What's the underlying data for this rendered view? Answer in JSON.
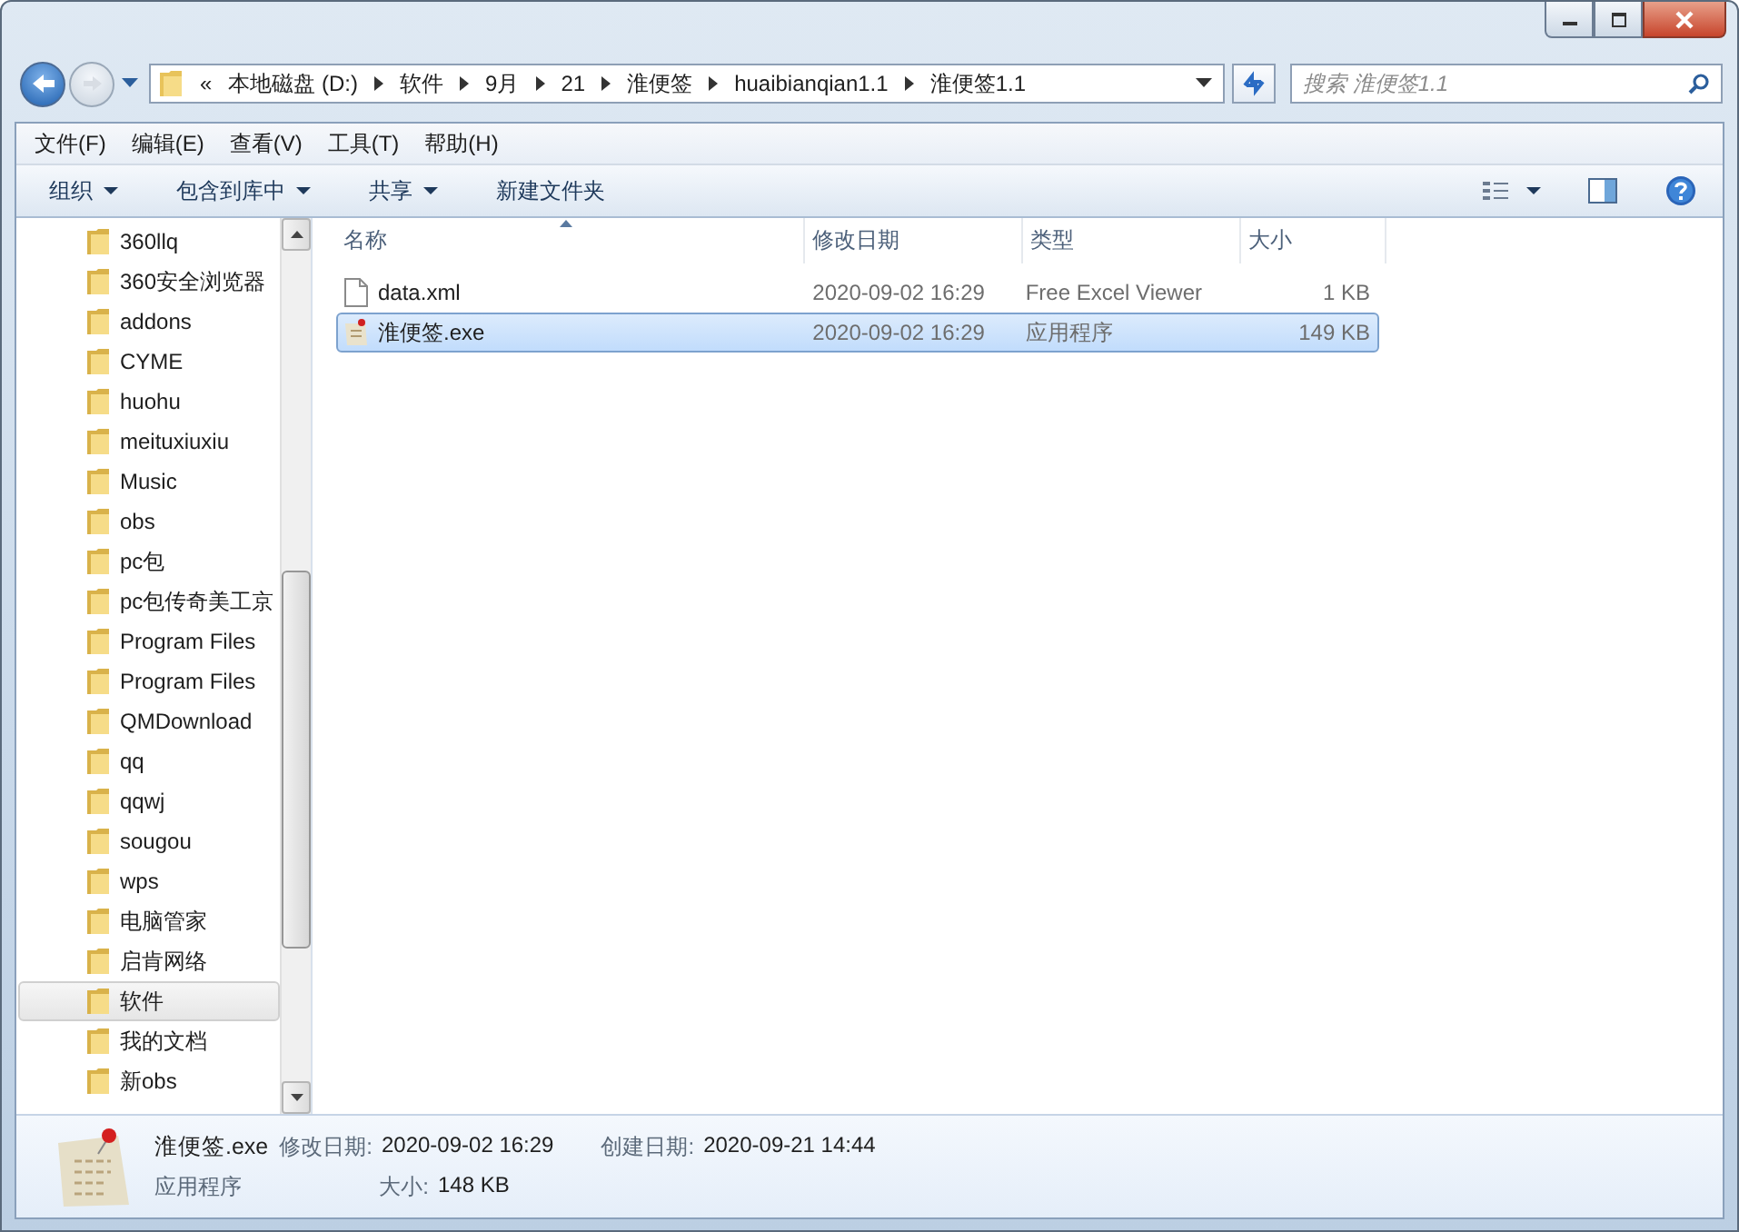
{
  "address": {
    "overflow": "«",
    "segments": [
      "本地磁盘 (D:)",
      "软件",
      "9月",
      "21",
      "淮便签",
      "huaibianqian1.1",
      "淮便签1.1"
    ]
  },
  "search": {
    "placeholder": "搜索 淮便签1.1"
  },
  "menu": [
    "文件(F)",
    "编辑(E)",
    "查看(V)",
    "工具(T)",
    "帮助(H)"
  ],
  "toolbar": [
    {
      "label": "组织",
      "dropdown": true
    },
    {
      "label": "包含到库中",
      "dropdown": true
    },
    {
      "label": "共享",
      "dropdown": true
    },
    {
      "label": "新建文件夹",
      "dropdown": false
    }
  ],
  "sidebar": {
    "items": [
      {
        "label": "360llq",
        "selected": false
      },
      {
        "label": "360安全浏览器",
        "selected": false
      },
      {
        "label": "addons",
        "selected": false
      },
      {
        "label": "CYME",
        "selected": false
      },
      {
        "label": "huohu",
        "selected": false
      },
      {
        "label": "meituxiuxiu",
        "selected": false
      },
      {
        "label": "Music",
        "selected": false
      },
      {
        "label": "obs",
        "selected": false
      },
      {
        "label": "pc包",
        "selected": false
      },
      {
        "label": "pc包传奇美工京",
        "selected": false
      },
      {
        "label": "Program Files",
        "selected": false
      },
      {
        "label": "Program Files",
        "selected": false
      },
      {
        "label": "QMDownload",
        "selected": false
      },
      {
        "label": "qq",
        "selected": false
      },
      {
        "label": "qqwj",
        "selected": false
      },
      {
        "label": "sougou",
        "selected": false
      },
      {
        "label": "wps",
        "selected": false
      },
      {
        "label": "电脑管家",
        "selected": false
      },
      {
        "label": "启肯网络",
        "selected": false
      },
      {
        "label": "软件",
        "selected": true
      },
      {
        "label": "我的文档",
        "selected": false
      },
      {
        "label": "新obs",
        "selected": false
      }
    ]
  },
  "table": {
    "columns": [
      {
        "label": "名称",
        "sorted": true
      },
      {
        "label": "修改日期",
        "sorted": false
      },
      {
        "label": "类型",
        "sorted": false
      },
      {
        "label": "大小",
        "sorted": false
      }
    ],
    "rows": [
      {
        "kind": "document",
        "name": "data.xml",
        "date": "2020-09-02 16:29",
        "type": "Free Excel Viewer",
        "size": "1 KB",
        "selected": false
      },
      {
        "kind": "app",
        "name": "淮便签.exe",
        "date": "2020-09-02 16:29",
        "type": "应用程序",
        "size": "149 KB",
        "selected": true
      }
    ]
  },
  "details": {
    "name": "淮便签.exe",
    "type": "应用程序",
    "fields": [
      {
        "label": "修改日期:",
        "value": "2020-09-02 16:29"
      },
      {
        "label": "创建日期:",
        "value": "2020-09-21 14:44"
      },
      {
        "label": "大小:",
        "value": "148 KB"
      }
    ]
  }
}
